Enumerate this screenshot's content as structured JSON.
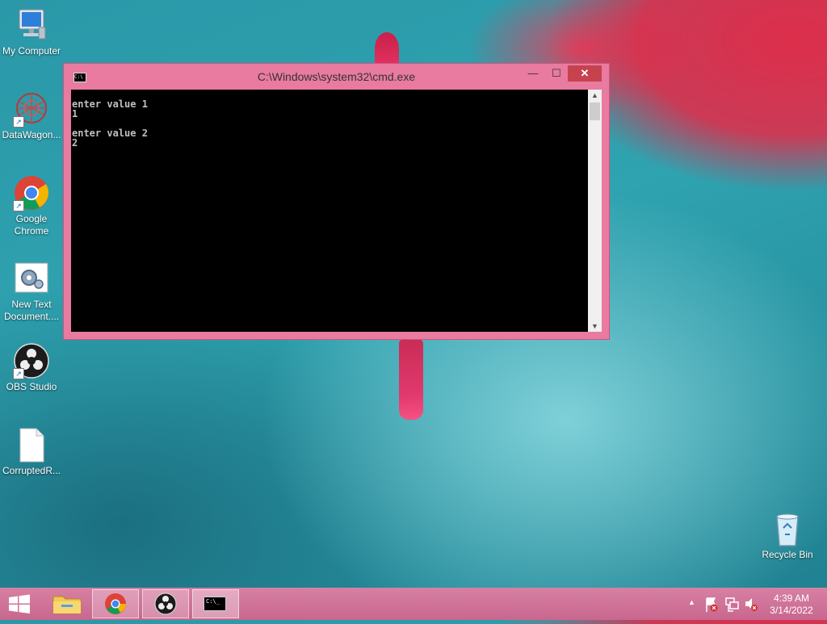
{
  "desktop": {
    "icons": [
      {
        "label": "My Computer"
      },
      {
        "label": "DataWagon..."
      },
      {
        "label": "Google Chrome"
      },
      {
        "label": "New Text Document...."
      },
      {
        "label": "OBS Studio"
      },
      {
        "label": "CorruptedR..."
      },
      {
        "label": "Recycle Bin"
      }
    ]
  },
  "cmd_window": {
    "title": "C:\\Windows\\system32\\cmd.exe",
    "system_icon_text": "C:\\",
    "buttons": {
      "minimize": "—",
      "maximize": "☐",
      "close": "✕"
    },
    "console_text": "enter value 1\n1\n\nenter value 2\n2"
  },
  "taskbar": {
    "apps": [
      {
        "name": "file-explorer"
      },
      {
        "name": "google-chrome"
      },
      {
        "name": "obs-studio"
      },
      {
        "name": "command-prompt",
        "label": "C:\\_"
      }
    ],
    "clock": {
      "time": "4:39 AM",
      "date": "3/14/2022"
    }
  },
  "colors": {
    "window_frame": "#e97aa0",
    "taskbar": "#cf7098",
    "close": "#c7424f"
  }
}
